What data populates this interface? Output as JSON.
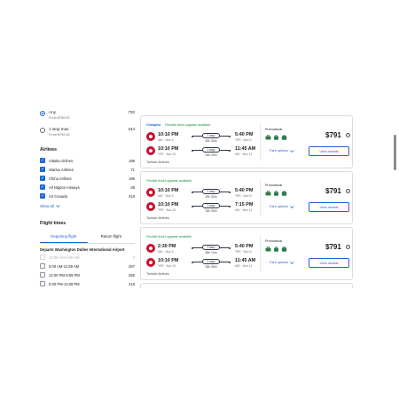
{
  "stops": [
    {
      "label": "Any",
      "sub": "From $790.52",
      "count": "730",
      "selected": true
    },
    {
      "label": "1 stop max",
      "sub": "From $790.52",
      "count": "244",
      "selected": false
    }
  ],
  "airlines": {
    "title": "Airlines",
    "items": [
      {
        "name": "Alaska Airlines",
        "count": "189"
      },
      {
        "name": "Starlux Airlines",
        "count": "71"
      },
      {
        "name": "China Airlines",
        "count": "196"
      },
      {
        "name": "All Nippon Airways",
        "count": "48"
      },
      {
        "name": "Air Canada",
        "count": "319"
      }
    ],
    "show_all": "Show all"
  },
  "flight_times": {
    "title": "Flight times",
    "tabs": [
      "Departing flight",
      "Return flight"
    ],
    "departs_label": "Departs Washington Dulles International Airport",
    "ranges": [
      {
        "label": "12:00 AM-5:59 AM",
        "count": "0",
        "disabled": true
      },
      {
        "label": "6:00 AM-11:59 AM",
        "count": "257",
        "disabled": false
      },
      {
        "label": "12:00 PM-5:59 PM",
        "count": "255",
        "disabled": false
      },
      {
        "label": "6:00 PM-11:59 PM",
        "count": "218",
        "disabled": false
      }
    ]
  },
  "results": [
    {
      "badges": [
        "Cheapest",
        "Flexible ticket upgrade available"
      ],
      "legs": [
        {
          "dep": "10:10 PM",
          "dep_sub": "IAD · Nov 3",
          "stop": "1 stop",
          "duration": "30h 30m",
          "arr": "5:40 PM",
          "arr_sub": "TPE · Nov 5"
        },
        {
          "dep": "10:10 PM",
          "dep_sub": "TPE · Nov 10",
          "stop": "1 stop",
          "duration": "28h 35m",
          "arr": "11:45 AM",
          "arr_sub": "IAD · Nov 11"
        }
      ],
      "airline": "Turkish Airlines",
      "promo": "Promotional",
      "price": "$791",
      "fare_options": "Fare options",
      "view_details": "View details"
    },
    {
      "badges": [
        "Flexible ticket upgrade available"
      ],
      "legs": [
        {
          "dep": "10:10 PM",
          "dep_sub": "IAD · Nov 3",
          "stop": "1 stop",
          "duration": "30h 30m",
          "arr": "5:40 PM",
          "arr_sub": "TPE · Nov 5"
        },
        {
          "dep": "10:10 PM",
          "dep_sub": "TPE · Nov 10",
          "stop": "1 stop",
          "duration": "28h 35m",
          "arr": "7:15 PM",
          "arr_sub": "IAD · Nov 11"
        }
      ],
      "airline": "Turkish Airlines",
      "promo": "Promotional",
      "price": "$791",
      "fare_options": "Fare options",
      "view_details": "View details"
    },
    {
      "badges": [
        "Flexible ticket upgrade available"
      ],
      "legs": [
        {
          "dep": "2:30 PM",
          "dep_sub": "IAD · Nov 3",
          "stop": "1 stop",
          "duration": "38h 10m",
          "arr": "5:40 PM",
          "arr_sub": "TPE · Nov 5"
        },
        {
          "dep": "10:10 PM",
          "dep_sub": "TPE · Nov 10",
          "stop": "1 stop",
          "duration": "28h 35m",
          "arr": "11:45 AM",
          "arr_sub": "IAD · Nov 11"
        }
      ],
      "airline": "Turkish Airlines",
      "promo": "Promotional",
      "price": "$791",
      "fare_options": "Fare options",
      "view_details": "View details"
    }
  ],
  "colors": {
    "accent": "#1c65d4",
    "flex_green": "#1e8e3e",
    "airline_red": "#c8102e"
  },
  "icons": [
    "radio-icon",
    "checkbox-icon",
    "chevron-down-icon",
    "airline-logo-icon",
    "bag-icon",
    "info-icon"
  ]
}
